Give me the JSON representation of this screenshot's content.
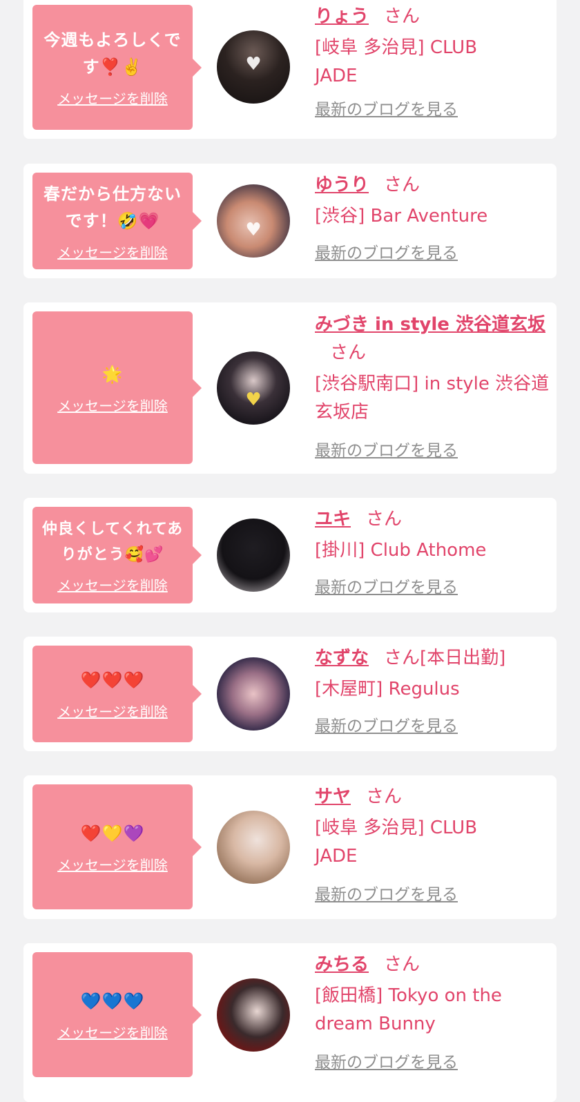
{
  "delete_label": "メッセージを削除",
  "blog_label": "最新のブログを見る",
  "san_label": "さん",
  "colors": {
    "page_bg": "#f2f2f3",
    "bubble": "#f6909c",
    "accent": "#e1446a",
    "link_gray": "#8e8e8e"
  },
  "items": [
    {
      "message": "今週もよろしくです❣️✌️",
      "name": "りょう",
      "status": "",
      "shop": "[岐阜 多治見] CLUB JADE",
      "avatar_icon": "avatar-photo"
    },
    {
      "message": "春だから仕方ないです！🤣💗",
      "name": "ゆうり",
      "status": "",
      "shop": "[渋谷] Bar Aventure",
      "avatar_icon": "avatar-photo"
    },
    {
      "message": "🌟",
      "name": "みづき in style 渋谷道玄坂",
      "status": "",
      "shop": "[渋谷駅南口] in style 渋谷道玄坂店",
      "avatar_icon": "avatar-photo"
    },
    {
      "message": "仲良くしてくれてありがとう🥰💕",
      "name": "ユキ",
      "status": "",
      "shop": "[掛川] Club Athome",
      "avatar_icon": "avatar-photo"
    },
    {
      "message": "❤️❤️❤️",
      "name": "なずな",
      "status": "[本日出勤]",
      "shop": "[木屋町] Regulus",
      "avatar_icon": "avatar-photo"
    },
    {
      "message": "❤️💛💜",
      "name": "サヤ",
      "status": "",
      "shop": "[岐阜 多治見] CLUB JADE",
      "avatar_icon": "avatar-photo"
    },
    {
      "message": "💙💙💙",
      "name": "みちる",
      "status": "",
      "shop": "[飯田橋] Tokyo on the dream Bunny",
      "avatar_icon": "avatar-photo"
    }
  ]
}
